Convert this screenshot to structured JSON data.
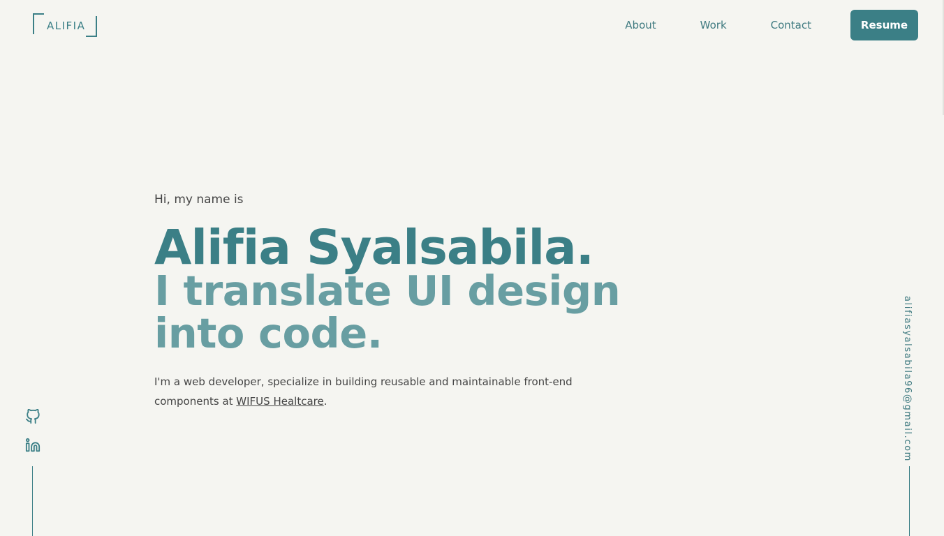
{
  "header": {
    "logo_text": "ALIFIA",
    "nav": {
      "about": "About",
      "work": "Work",
      "contact": "Contact",
      "resume": "Resume"
    }
  },
  "hero": {
    "greeting": "Hi, my name is",
    "name": "Alifia Syalsabila.",
    "tagline": "I translate UI design into code.",
    "bio_prefix": "I'm a web developer, specialize in building reusable and maintainable front-end components at ",
    "bio_link": "WIFUS Healtcare",
    "bio_suffix": "."
  },
  "sidebar": {
    "email": "alifiasyalsabila96@gmail.com",
    "icons": [
      "github-icon",
      "linkedin-icon"
    ]
  },
  "colors": {
    "background": "#f5f5f1",
    "accent": "#3b7f86",
    "accent_light": "#689ea2",
    "text": "#444444"
  }
}
